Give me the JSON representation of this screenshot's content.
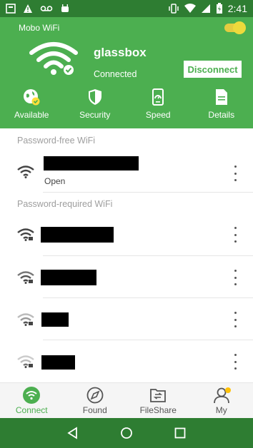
{
  "status_bar": {
    "time": "2:41"
  },
  "header": {
    "app_name": "Mobo WiFi",
    "ssid": "glassbox",
    "connection_status": "Connected",
    "disconnect_label": "Disconnect",
    "tools": [
      {
        "label": "Available",
        "icon": "globe-check-icon"
      },
      {
        "label": "Security",
        "icon": "shield-icon"
      },
      {
        "label": "Speed",
        "icon": "speedometer-phone-icon"
      },
      {
        "label": "Details",
        "icon": "document-icon"
      }
    ],
    "toggle_on": true
  },
  "sections": {
    "password_free_title": "Password-free WiFi",
    "password_required_title": "Password-required WiFi"
  },
  "networks": {
    "free": [
      {
        "sub": "Open"
      }
    ]
  },
  "bottom_nav": [
    {
      "label": "Connect",
      "icon": "wifi-circle-icon",
      "active": true
    },
    {
      "label": "Found",
      "icon": "compass-icon",
      "active": false
    },
    {
      "label": "FileShare",
      "icon": "folder-share-icon",
      "active": false
    },
    {
      "label": "My",
      "icon": "person-icon",
      "active": false,
      "badge": true
    }
  ],
  "colors": {
    "brand_green": "#4caf50",
    "status_green": "#2e7d32",
    "toggle_yellow": "#ffdf3a",
    "badge": "#ffc107"
  }
}
